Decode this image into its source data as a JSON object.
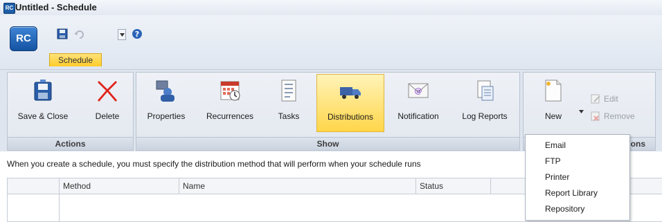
{
  "window": {
    "title": "Untitled - Schedule",
    "app_icon_text": "RC"
  },
  "quick_access": {
    "app_button_text": "RC"
  },
  "tabs": [
    {
      "label": "Schedule",
      "active": true
    }
  ],
  "ribbon": {
    "groups": [
      {
        "label": "Actions",
        "buttons": [
          {
            "label": "Save & Close",
            "icon": "save-close-icon"
          },
          {
            "label": "Delete",
            "icon": "delete-icon"
          }
        ]
      },
      {
        "label": "Show",
        "buttons": [
          {
            "label": "Properties",
            "icon": "properties-icon"
          },
          {
            "label": "Recurrences",
            "icon": "recurrences-icon"
          },
          {
            "label": "Tasks",
            "icon": "tasks-icon"
          },
          {
            "label": "Distributions",
            "icon": "distributions-icon",
            "active": true
          },
          {
            "label": "Notification",
            "icon": "notification-icon"
          },
          {
            "label": "Log Reports",
            "icon": "log-reports-icon"
          }
        ]
      },
      {
        "label": "ons",
        "buttons": [
          {
            "label": "New",
            "icon": "new-document-icon"
          }
        ],
        "small_buttons": [
          {
            "label": "Edit",
            "icon": "edit-icon"
          },
          {
            "label": "Remove",
            "icon": "remove-icon"
          }
        ]
      }
    ]
  },
  "description": "When you create a schedule, you must specify the distribution method that will perform when your schedule runs",
  "table": {
    "columns": [
      "",
      "Method",
      "Name",
      "Status",
      ""
    ]
  },
  "new_menu": {
    "items": [
      "Email",
      "FTP",
      "Printer",
      "Report Library",
      "Repository"
    ]
  },
  "colors": {
    "accent": "#ffd64a",
    "ribbon": "#dfe5ee",
    "app_button": "#1f5fa8"
  }
}
